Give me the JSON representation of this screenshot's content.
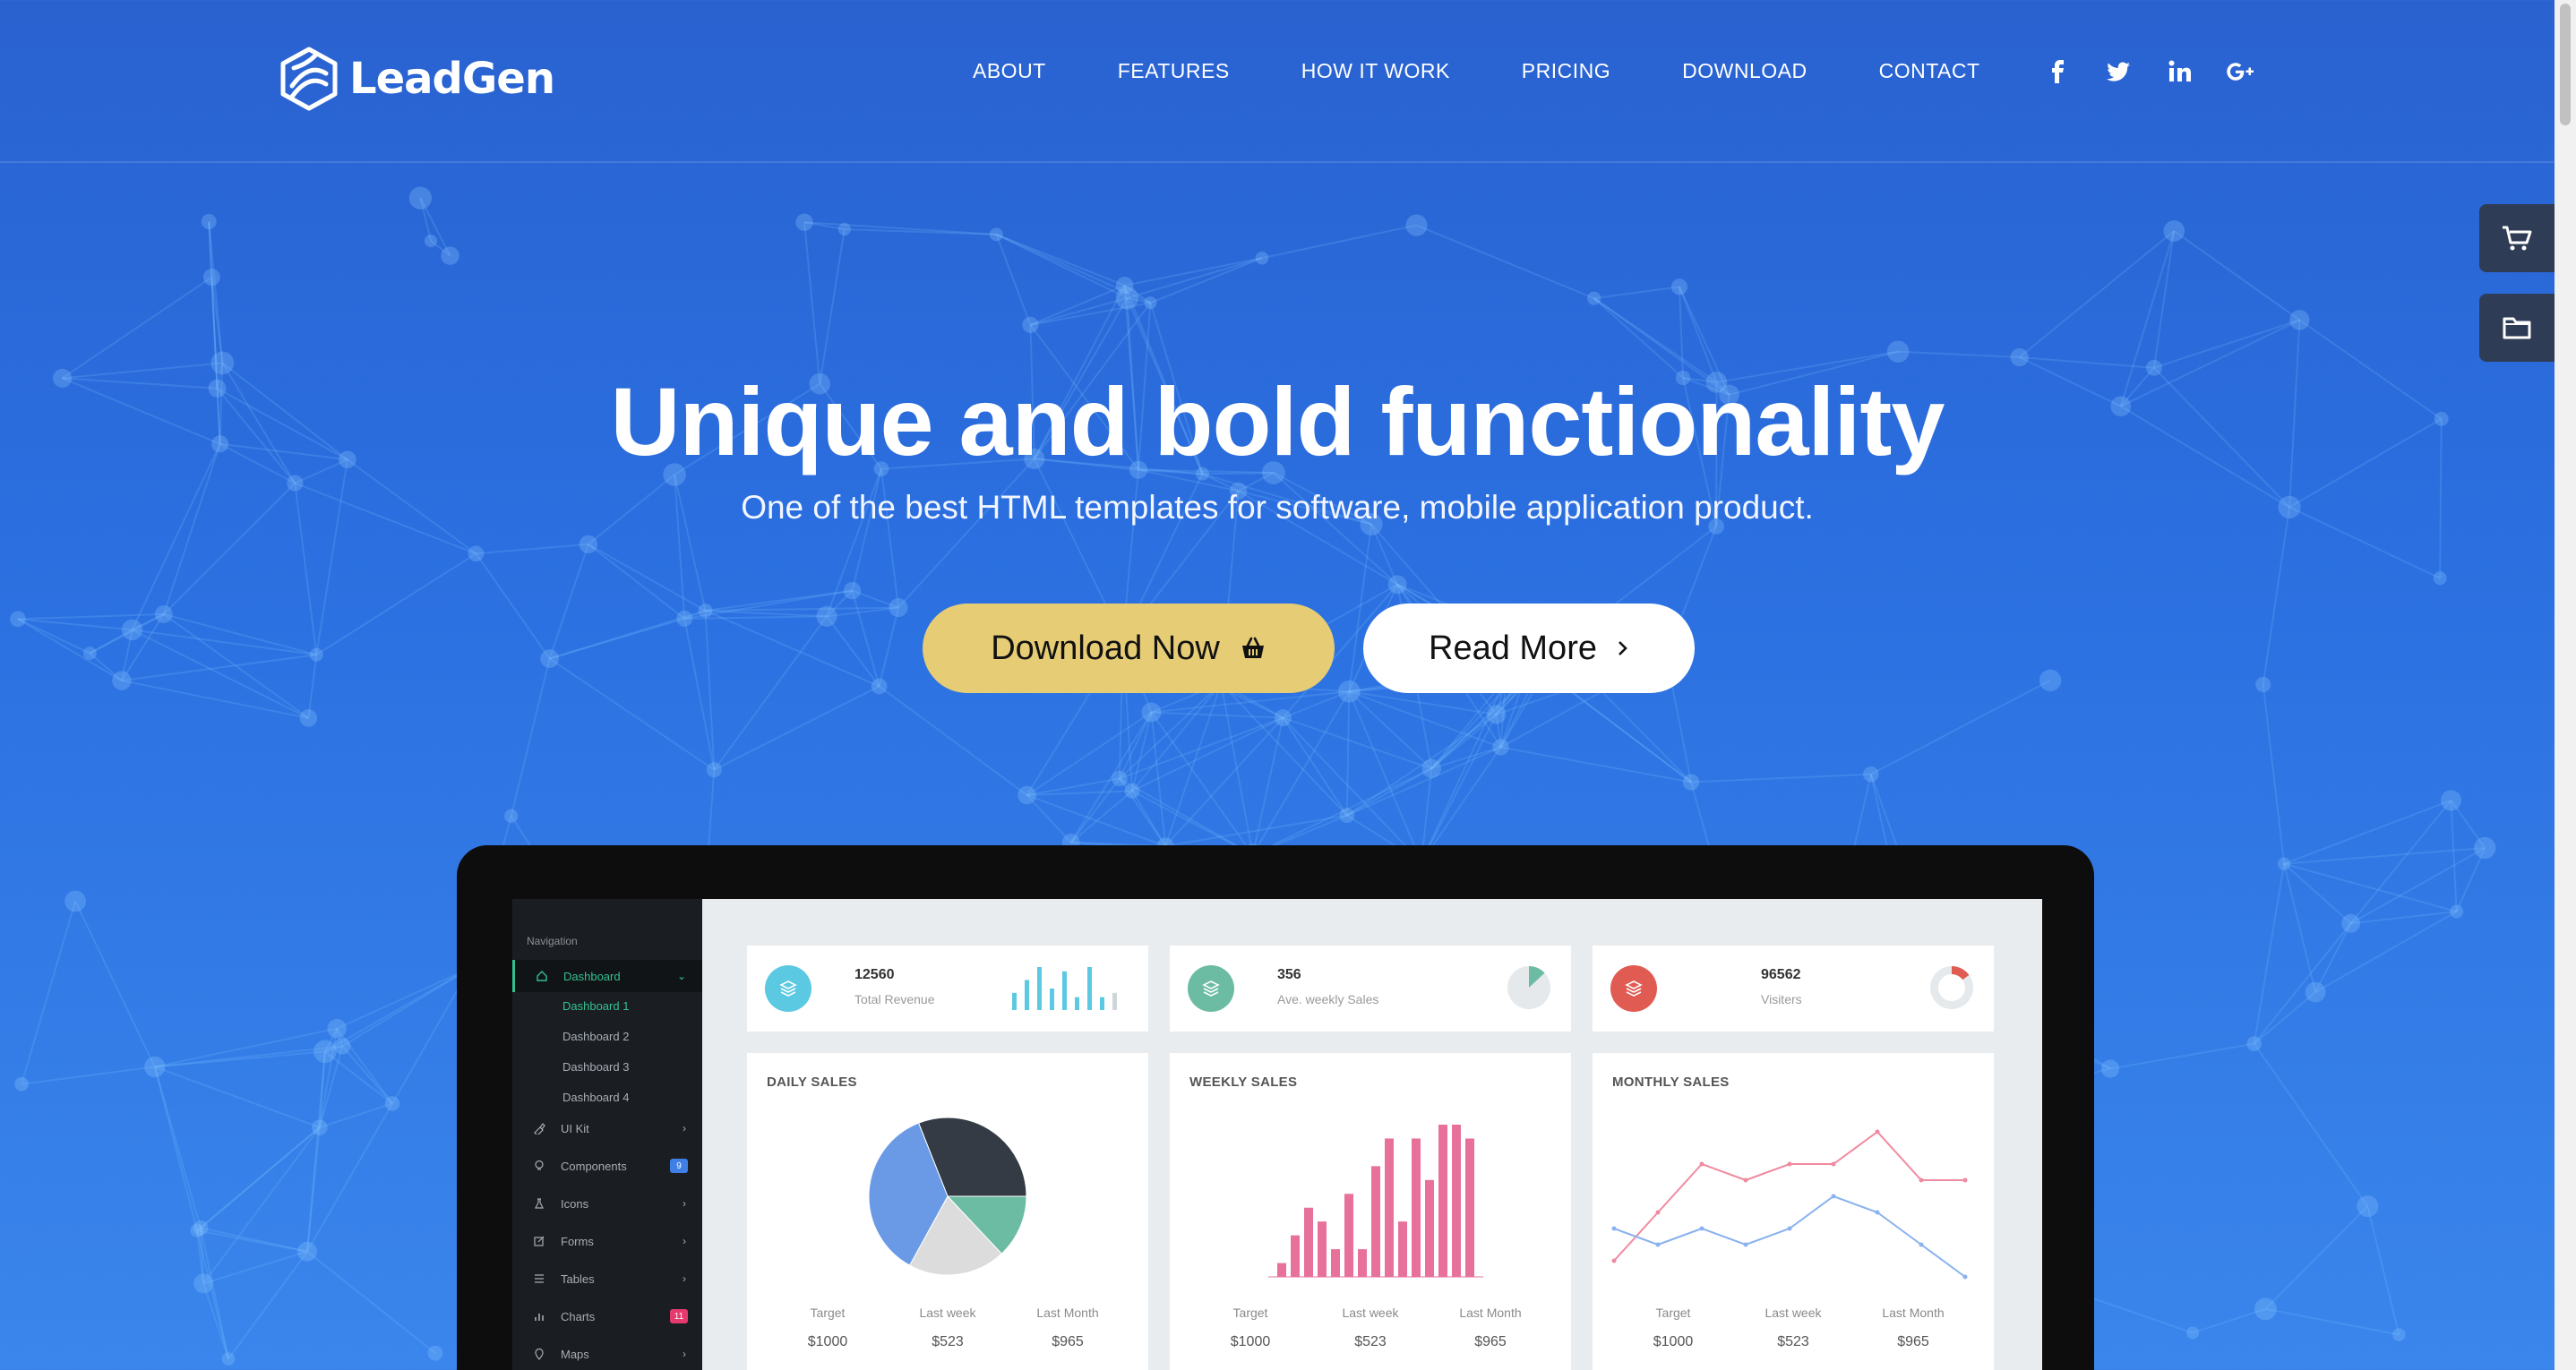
{
  "brand": {
    "name": "LeadGen"
  },
  "nav": {
    "items": [
      "ABOUT",
      "FEATURES",
      "HOW IT WORK",
      "PRICING",
      "DOWNLOAD",
      "CONTACT"
    ],
    "social": [
      "facebook-icon",
      "twitter-icon",
      "linkedin-icon",
      "google-plus-icon"
    ]
  },
  "side_tabs": [
    "cart-icon",
    "folder-icon"
  ],
  "hero": {
    "title": "Unique and bold functionality",
    "subtitle": "One of the best HTML templates for software, mobile application product.",
    "download_label": "Download Now",
    "read_more_label": "Read More"
  },
  "colors": {
    "accent_yellow": "#e5cc75",
    "dash_green": "#33c08e",
    "cyan": "#5bc9e1",
    "teal": "#6cbca4",
    "red": "#e05c52",
    "pink": "#e7719b",
    "blue": "#6a9ae6"
  },
  "dashboard": {
    "sidebar": {
      "heading": "Navigation",
      "items": [
        {
          "label": "Dashboard",
          "icon": "home-icon",
          "active": true
        },
        {
          "label": "UI Kit",
          "icon": "brush-icon"
        },
        {
          "label": "Components",
          "icon": "bulb-icon",
          "badge": "9"
        },
        {
          "label": "Icons",
          "icon": "flask-icon"
        },
        {
          "label": "Forms",
          "icon": "edit-icon"
        },
        {
          "label": "Tables",
          "icon": "list-icon"
        },
        {
          "label": "Charts",
          "icon": "bar-chart-icon",
          "badge": "11"
        },
        {
          "label": "Maps",
          "icon": "map-pin-icon"
        }
      ],
      "sub_items": [
        "Dashboard 1",
        "Dashboard 2",
        "Dashboard 3",
        "Dashboard 4"
      ]
    },
    "stats": [
      {
        "value": "12560",
        "label": "Total Revenue",
        "icon": "layers-icon"
      },
      {
        "value": "356",
        "label": "Ave. weekly Sales",
        "icon": "layers-icon"
      },
      {
        "value": "96562",
        "label": "Visiters",
        "icon": "layers-icon"
      }
    ],
    "panels": [
      {
        "title": "DAILY SALES"
      },
      {
        "title": "WEEKLY SALES"
      },
      {
        "title": "MONTHLY SALES"
      }
    ],
    "footer_labels": [
      "Target",
      "Last week",
      "Last Month"
    ],
    "footer_values": [
      "$1000",
      "$523",
      "$965"
    ]
  },
  "chart_data": [
    {
      "type": "bar",
      "values": [
        4,
        7,
        10,
        5,
        9,
        3,
        10,
        3,
        4
      ],
      "note_source": "Total Revenue sparkline"
    },
    {
      "type": "pie",
      "values": [
        13,
        87
      ],
      "note_source": "Ave. weekly Sales mini pie"
    },
    {
      "type": "pie",
      "values": [
        15,
        85
      ],
      "note_source": "Visiters mini donut"
    },
    {
      "type": "pie",
      "labels": [
        "",
        "",
        "",
        ""
      ],
      "values": [
        31,
        13,
        20,
        36
      ],
      "title": "DAILY SALES"
    },
    {
      "type": "bar",
      "values": [
        1,
        3,
        5,
        4,
        2,
        6,
        2,
        8,
        10,
        4,
        10,
        7,
        11,
        11,
        10
      ],
      "title": "WEEKLY SALES"
    },
    {
      "type": "line",
      "series": [
        {
          "values": [
            1,
            4,
            7,
            6,
            7,
            7,
            9,
            6,
            6
          ]
        },
        {
          "values": [
            3,
            2,
            3,
            2,
            3,
            5,
            4,
            2,
            0
          ]
        }
      ],
      "title": "MONTHLY SALES"
    }
  ]
}
